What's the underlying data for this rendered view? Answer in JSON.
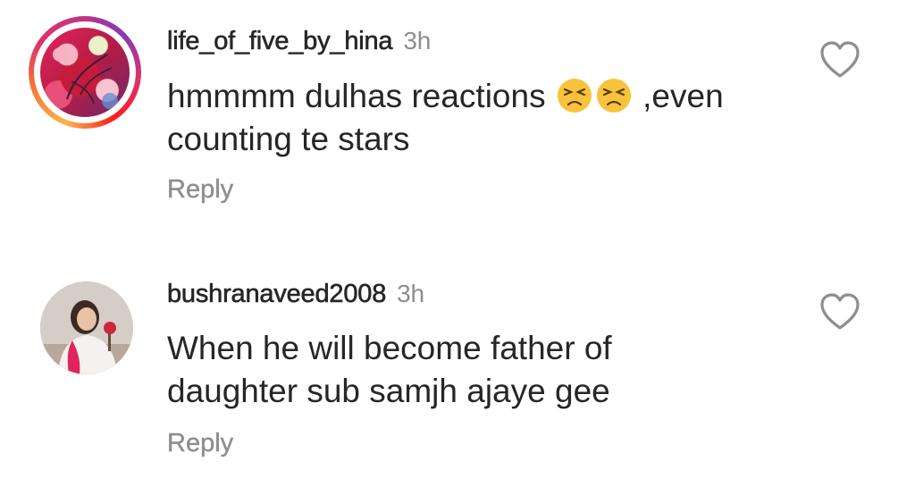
{
  "comments": [
    {
      "username": "life_of_five_by_hina",
      "time": "3h",
      "text_before": "hmmmm dulhas reactions",
      "emojis": [
        "tired-face",
        "tired-face"
      ],
      "text_after": " ,even",
      "text_line2": "counting te stars",
      "reply_label": "Reply"
    },
    {
      "username": "bushranaveed2008",
      "time": "3h",
      "text_line1": "When he will become father of",
      "text_line2": "daughter sub samjh ajaye gee",
      "reply_label": "Reply"
    }
  ],
  "colors": {
    "text": "#262626",
    "secondary": "#8e8e8e",
    "emoji": "#f7c33a"
  }
}
